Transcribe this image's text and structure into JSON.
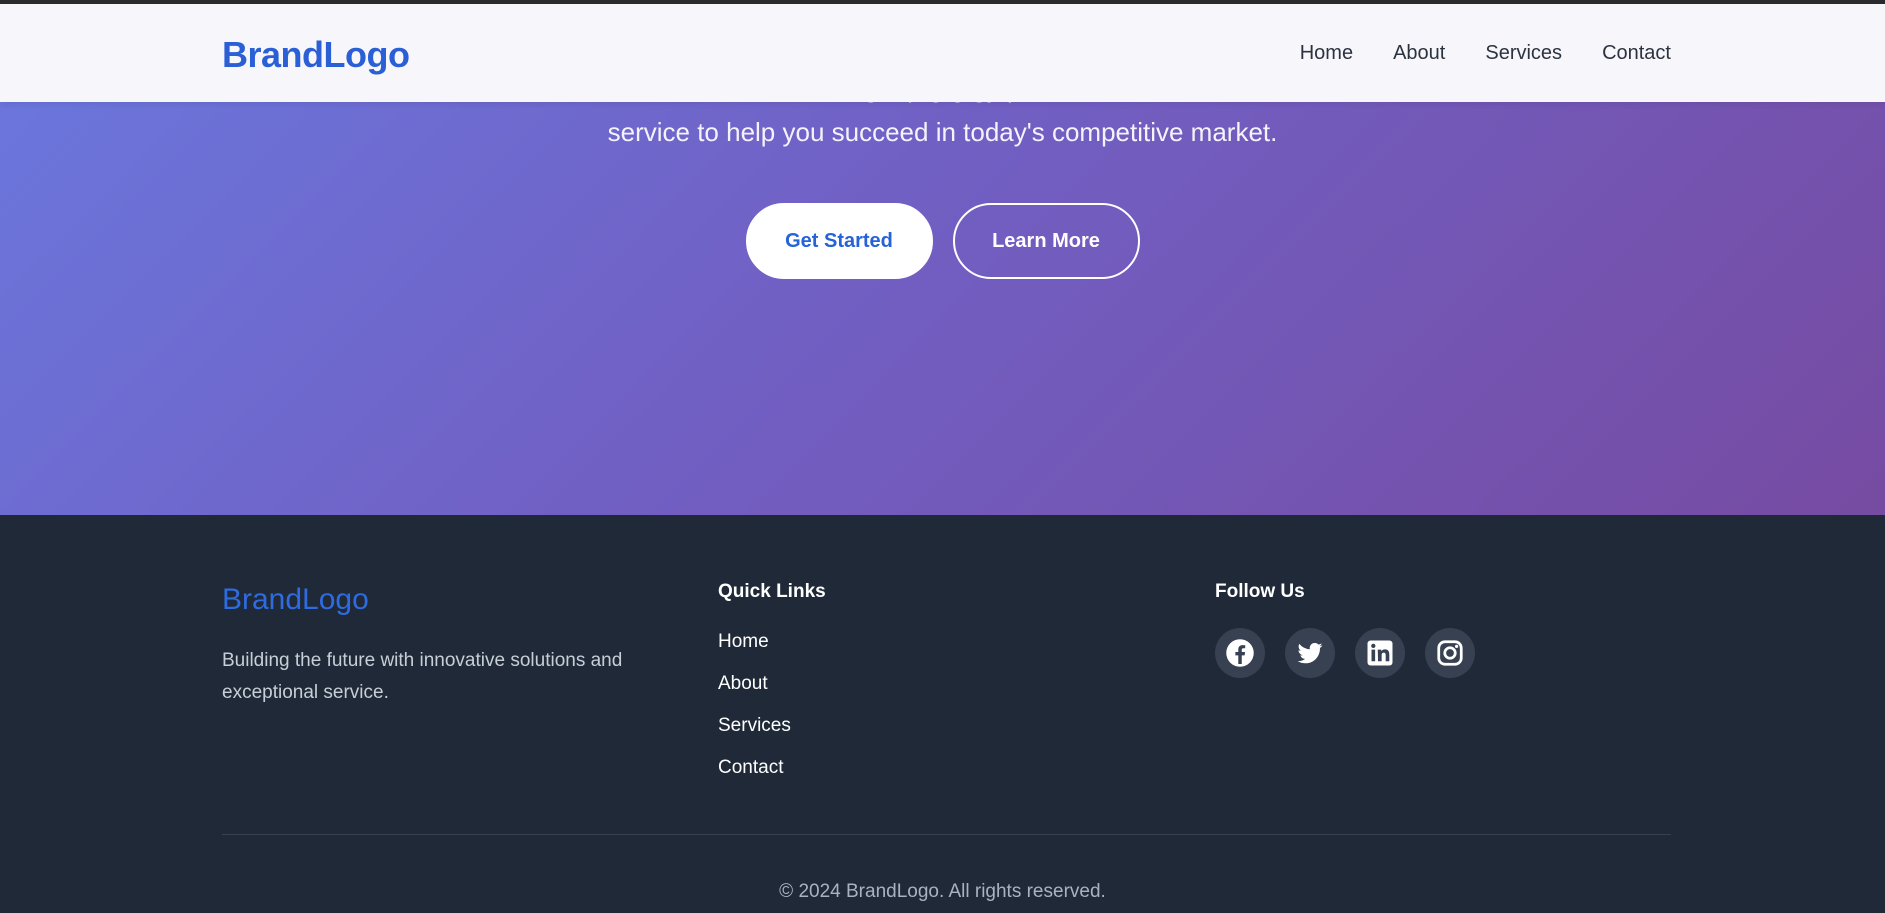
{
  "navbar": {
    "brand": "BrandLogo",
    "links": [
      "Home",
      "About",
      "Services",
      "Contact"
    ]
  },
  "hero": {
    "text_line1": "g   o   p       g  g       gy   p",
    "text_line2": "service to help you succeed in today's competitive market.",
    "primary_button": "Get Started",
    "secondary_button": "Learn More"
  },
  "footer": {
    "brand": "BrandLogo",
    "description": "Building the future with innovative solutions and exceptional service.",
    "quick_links_heading": "Quick Links",
    "quick_links": [
      "Home",
      "About",
      "Services",
      "Contact"
    ],
    "follow_heading": "Follow Us",
    "social_icons": [
      "facebook-icon",
      "twitter-icon",
      "linkedin-icon",
      "instagram-icon"
    ],
    "copyright": "© 2024 BrandLogo. All rights reserved."
  },
  "colors": {
    "brand_blue": "#2a5fd6",
    "hero_gradient_start": "#6a78de",
    "hero_gradient_end": "#764ba2",
    "footer_bg": "#1f2937"
  }
}
